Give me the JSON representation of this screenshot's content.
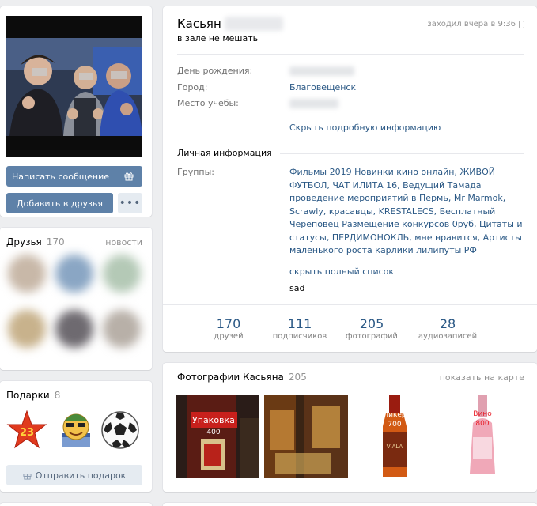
{
  "profile": {
    "first_name": "Касьян",
    "status": "в зале не мешать",
    "last_seen": "заходил вчера в 9:36",
    "info": {
      "birthday_label": "День рождения:",
      "city_label": "Город:",
      "city_value": "Благовещенск",
      "study_label": "Место учёбы:",
      "hide_details": "Скрыть подробную информацию"
    },
    "personal": {
      "title": "Личная информация",
      "groups_label": "Группы:",
      "groups_text": "Фильмы 2019 Новинки кино онлайн, ЖИВОЙ ФУТБОЛ, ЧАТ ИЛИТА 16, Ведущий Тамада проведение мероприятий в Пермь, Mr Marmok, Scrawly, красавцы, KRESTALECS, Бесплатный Череповец Размещение конкурсов 0руб, Цитаты и статусы, ПЕРДИМОНОКЛЬ, мне нравится, Артисты маленького роста карлики лилипуты РФ",
      "hide_list": "скрыть полный список",
      "extra": "sad"
    },
    "stats": [
      {
        "num": "170",
        "cap": "друзей"
      },
      {
        "num": "111",
        "cap": "подписчиков"
      },
      {
        "num": "205",
        "cap": "фотографий"
      },
      {
        "num": "28",
        "cap": "аудиозаписей"
      }
    ]
  },
  "actions": {
    "send_message": "Написать сообщение",
    "add_friend": "Добавить в друзья",
    "more": "•••"
  },
  "friends": {
    "title": "Друзья",
    "count": "170",
    "link": "новости"
  },
  "gifts": {
    "title": "Подарки",
    "count": "8",
    "send": "Отправить подарок",
    "star_text": "23"
  },
  "photos": {
    "title": "Фотографии Касьяна",
    "count": "205",
    "map_link": "показать на карте",
    "photo1_text": "Упаковка",
    "photo1_num": "400",
    "photo3_text": "Ликер",
    "photo3_num": "700",
    "photo3_brand": "VIALA",
    "photo4_text": "Вино",
    "photo4_num": "800"
  },
  "colors": {
    "accent": "#5e81a8",
    "link": "#2a5885",
    "muted": "#939393"
  }
}
